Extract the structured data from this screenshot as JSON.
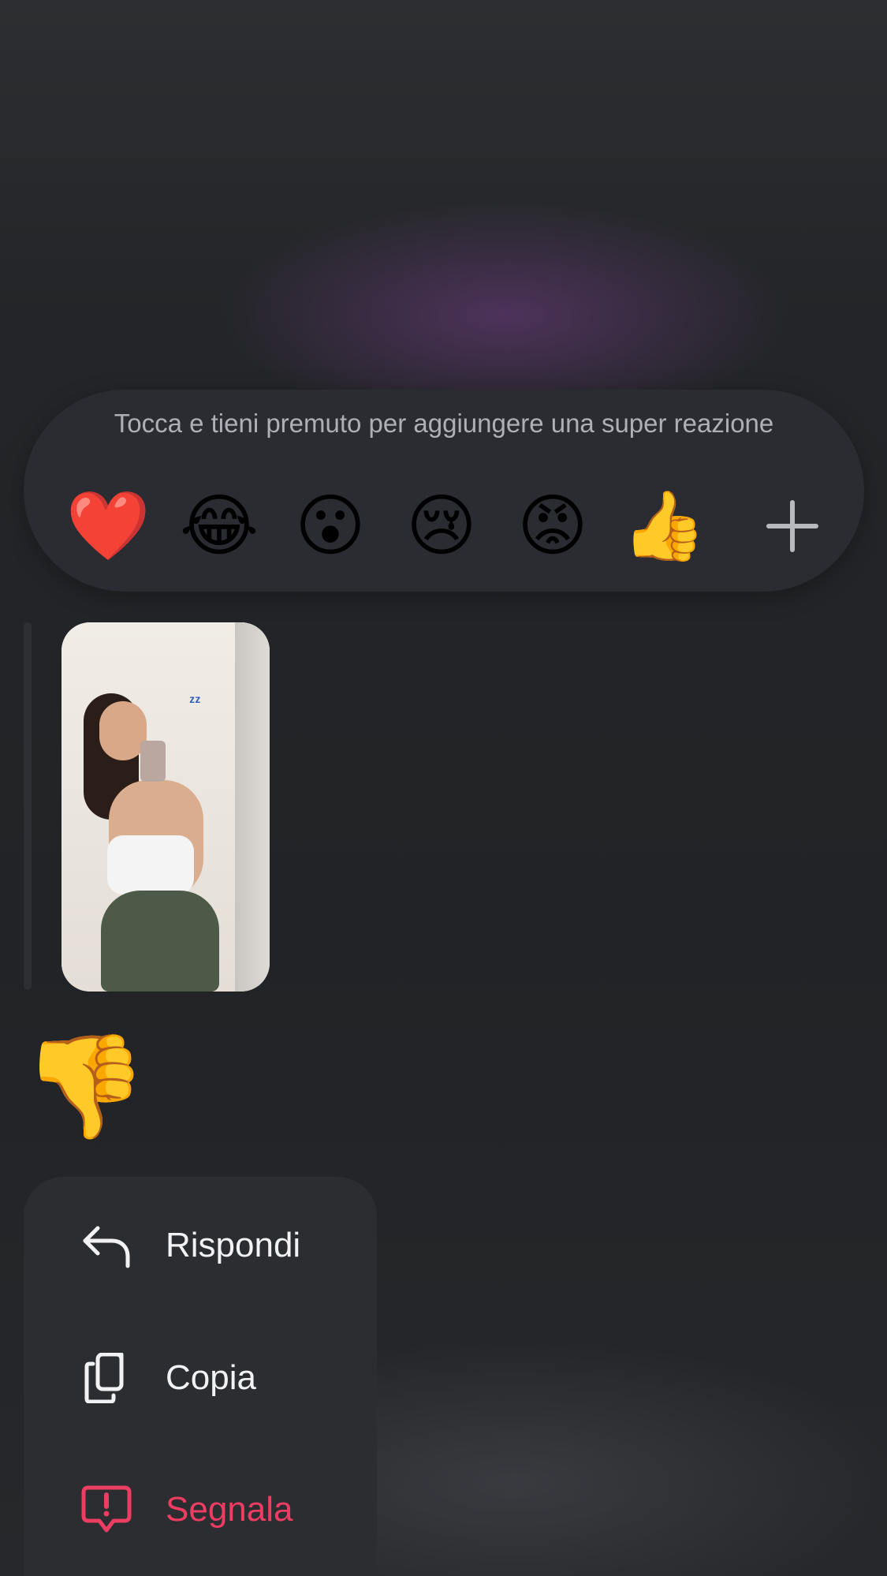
{
  "reaction_bar": {
    "hint": "Tocca e tieni premuto per aggiungere una super reazione",
    "emojis": [
      {
        "name": "red-heart",
        "glyph": "❤️"
      },
      {
        "name": "tears-of-joy",
        "glyph": "😂"
      },
      {
        "name": "surprised",
        "glyph": "😮"
      },
      {
        "name": "crying",
        "glyph": "😢"
      },
      {
        "name": "angry",
        "glyph": "😡"
      },
      {
        "name": "thumbs-up",
        "glyph": "👍"
      }
    ],
    "more_icon": "plus-icon"
  },
  "message": {
    "type": "photo",
    "sticker": {
      "name": "thumbs-down",
      "glyph": "👎"
    }
  },
  "menu": {
    "items": [
      {
        "label": "Rispondi",
        "icon": "reply-icon",
        "color": "#f2f2f4"
      },
      {
        "label": "Copia",
        "icon": "copy-icon",
        "color": "#f2f2f4"
      },
      {
        "label": "Segnala",
        "icon": "report-icon",
        "color": "#ee3d63"
      }
    ]
  },
  "colors": {
    "background": "#1f2124",
    "panel": "#2b2d31",
    "accent_danger": "#ee3d63",
    "hint_text": "#aeb0b5"
  }
}
